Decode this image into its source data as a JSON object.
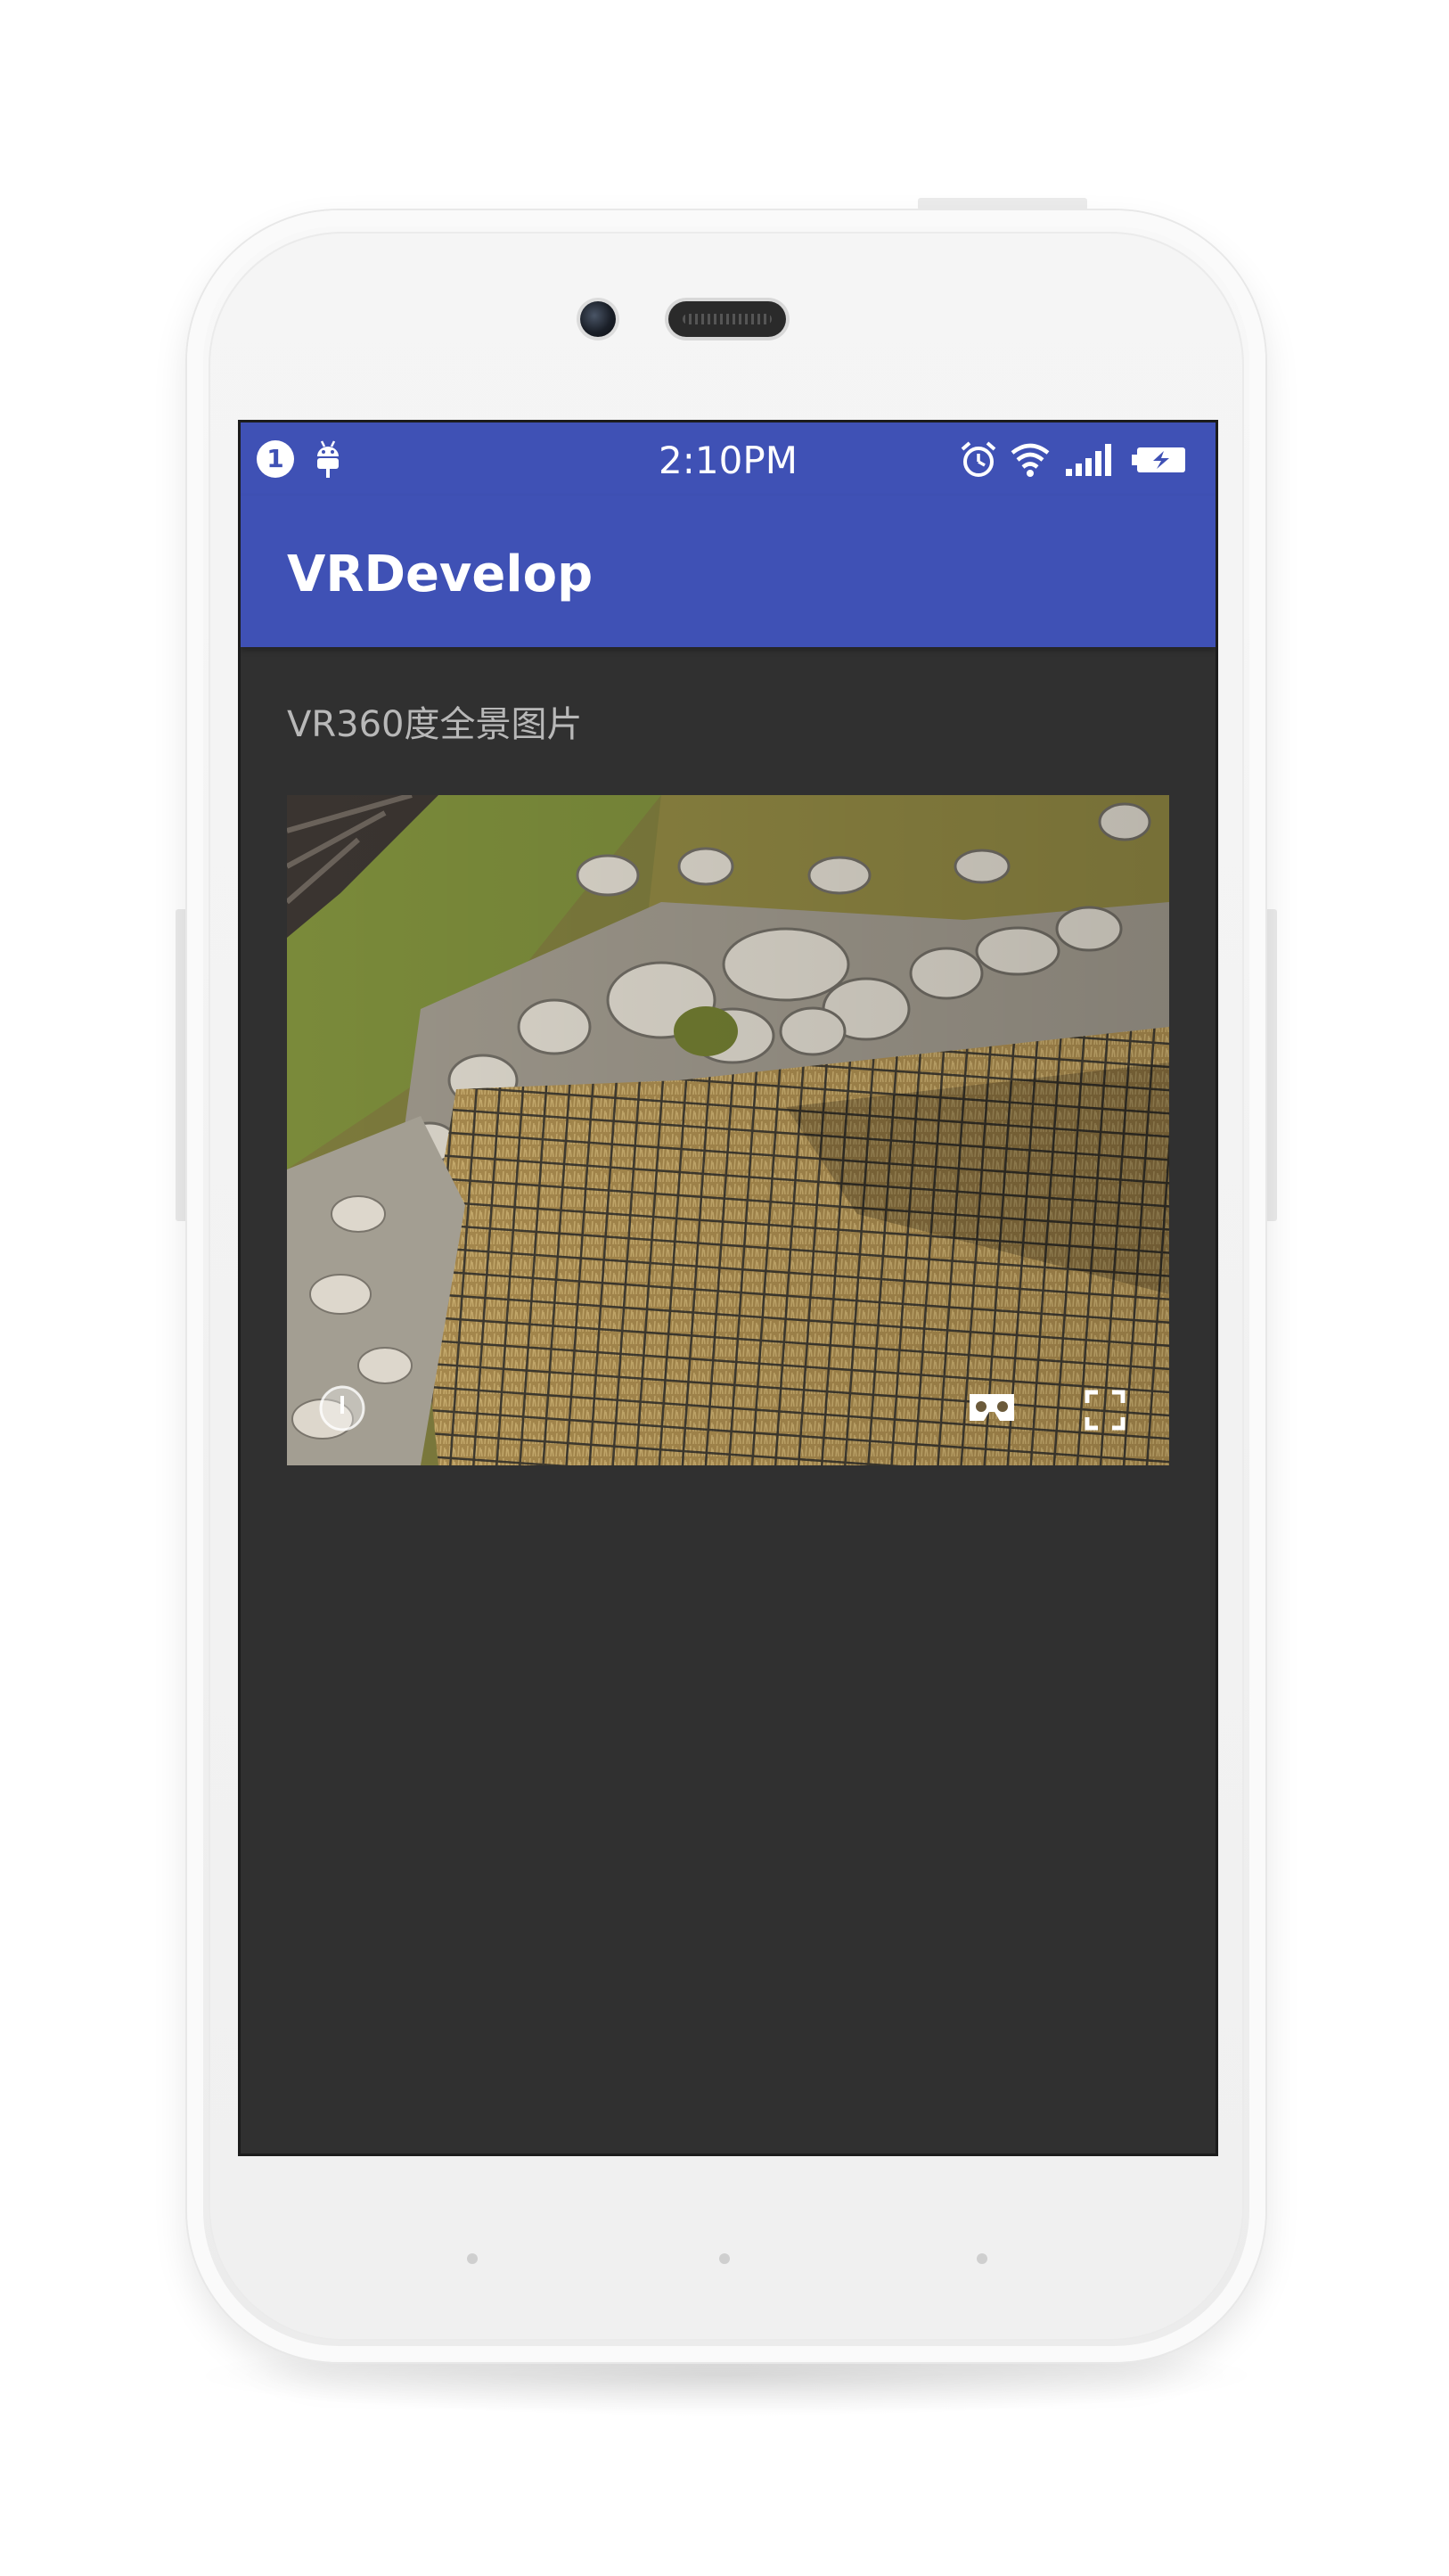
{
  "status_bar": {
    "notification_count": "1",
    "time": "2:10PM",
    "icons": [
      "notification-badge",
      "android-debug-icon",
      "alarm-icon",
      "wifi-icon",
      "signal-icon",
      "battery-charging-icon"
    ]
  },
  "app_bar": {
    "title": "VRDevelop"
  },
  "main": {
    "section_label": "VR360度全景图片",
    "panorama": {
      "controls": [
        "compass-icon",
        "cardboard-icon",
        "fullscreen-icon"
      ]
    }
  },
  "colors": {
    "primary": "#3f51b5",
    "background": "#303030",
    "label_text": "#b8b8b8"
  }
}
